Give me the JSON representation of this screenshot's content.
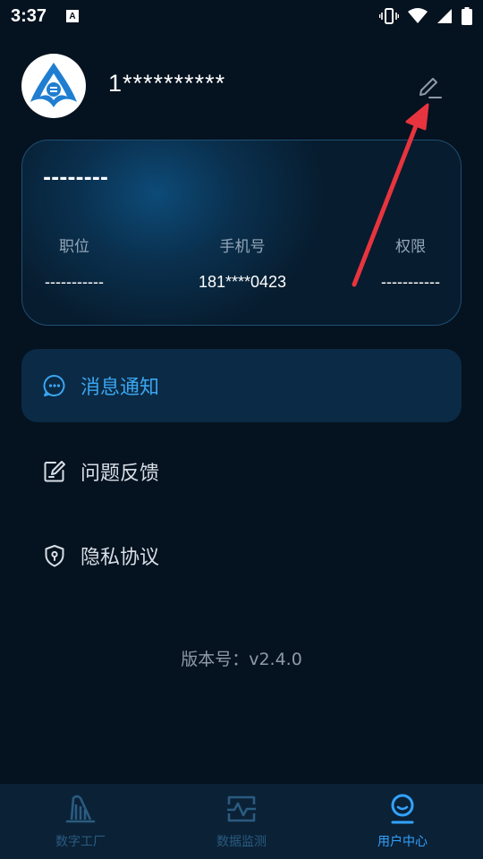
{
  "status_bar": {
    "time": "3:37",
    "icons": [
      "a-notification-icon",
      "vibrate-icon",
      "wifi-icon",
      "signal-icon",
      "battery-icon"
    ]
  },
  "profile": {
    "username": "1**********",
    "avatar_icon": "app-logo-icon",
    "edit_icon": "pencil-icon"
  },
  "card": {
    "name": "--------",
    "position_label": "职位",
    "position_value": "-----------",
    "phone_label": "手机号",
    "phone_value": "181****0423",
    "permission_label": "权限",
    "permission_value": "-----------"
  },
  "menu": [
    {
      "label": "消息通知",
      "icon": "message-icon",
      "active": true
    },
    {
      "label": "问题反馈",
      "icon": "feedback-edit-icon",
      "active": false
    },
    {
      "label": "隐私协议",
      "icon": "shield-icon",
      "active": false
    }
  ],
  "version": "版本号：v2.4.0",
  "bottom_nav": [
    {
      "label": "数字工厂",
      "icon": "factory-icon",
      "active": false
    },
    {
      "label": "数据监测",
      "icon": "monitor-icon",
      "active": false
    },
    {
      "label": "用户中心",
      "icon": "user-icon",
      "active": true
    }
  ],
  "colors": {
    "background": "#05121f",
    "accent": "#3aa6f0",
    "annotation_arrow": "#e8343e"
  }
}
